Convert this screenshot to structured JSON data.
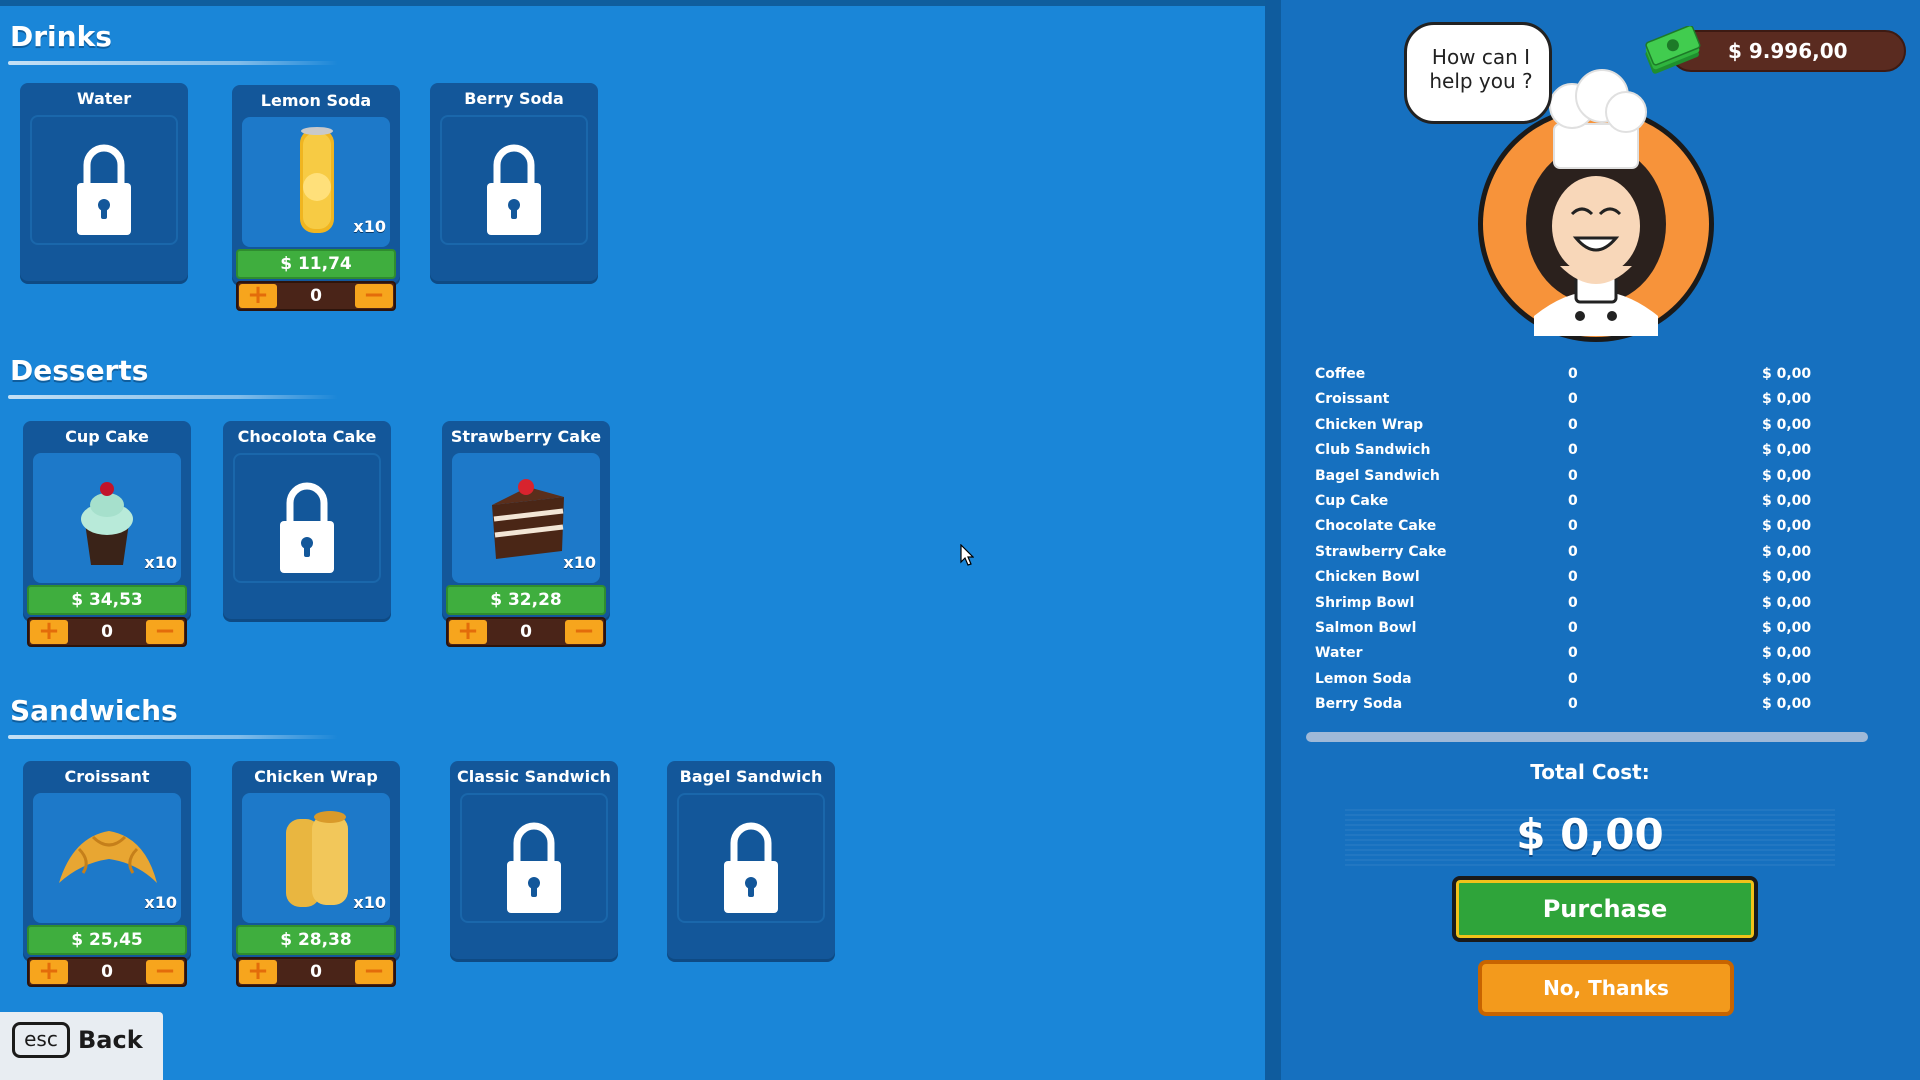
{
  "sections": {
    "drinks": {
      "title": "Drinks"
    },
    "desserts": {
      "title": "Desserts"
    },
    "sandwichs": {
      "title": "Sandwichs"
    }
  },
  "items": {
    "water": {
      "name": "Water",
      "locked": true
    },
    "lemon_soda": {
      "name": "Lemon Soda",
      "price": "$ 11,74",
      "qty_tag": "x10",
      "count": "0"
    },
    "berry_soda": {
      "name": "Berry Soda",
      "locked": true
    },
    "cup_cake": {
      "name": "Cup Cake",
      "price": "$ 34,53",
      "qty_tag": "x10",
      "count": "0"
    },
    "chocolota_cake": {
      "name": "Chocolota Cake",
      "locked": true
    },
    "strawberry_cake": {
      "name": "Strawberry Cake",
      "price": "$ 32,28",
      "qty_tag": "x10",
      "count": "0"
    },
    "croissant": {
      "name": "Croissant",
      "price": "$ 25,45",
      "qty_tag": "x10",
      "count": "0"
    },
    "chicken_wrap": {
      "name": "Chicken Wrap",
      "price": "$ 28,38",
      "qty_tag": "x10",
      "count": "0"
    },
    "classic_sandwich": {
      "name": "Classic Sandwich",
      "locked": true
    },
    "bagel_sandwich": {
      "name": "Bagel Sandwich",
      "locked": true
    }
  },
  "stepper": {
    "plus": "+",
    "minus": "−"
  },
  "back": {
    "key": "esc",
    "label": "Back"
  },
  "wallet": {
    "amount": "$ 9.996,00",
    "icon": "cash-stack-icon"
  },
  "chef": {
    "speech": "How can I help you ?"
  },
  "order": [
    {
      "name": "Coffee",
      "qty": "0",
      "cost": "$ 0,00"
    },
    {
      "name": "Croissant",
      "qty": "0",
      "cost": "$ 0,00"
    },
    {
      "name": "Chicken Wrap",
      "qty": "0",
      "cost": "$ 0,00"
    },
    {
      "name": "Club Sandwich",
      "qty": "0",
      "cost": "$ 0,00"
    },
    {
      "name": "Bagel Sandwich",
      "qty": "0",
      "cost": "$ 0,00"
    },
    {
      "name": "Cup Cake",
      "qty": "0",
      "cost": "$ 0,00"
    },
    {
      "name": "Chocolate Cake",
      "qty": "0",
      "cost": "$ 0,00"
    },
    {
      "name": "Strawberry Cake",
      "qty": "0",
      "cost": "$ 0,00"
    },
    {
      "name": "Chicken Bowl",
      "qty": "0",
      "cost": "$ 0,00"
    },
    {
      "name": "Shrimp Bowl",
      "qty": "0",
      "cost": "$ 0,00"
    },
    {
      "name": "Salmon Bowl",
      "qty": "0",
      "cost": "$ 0,00"
    },
    {
      "name": "Water",
      "qty": "0",
      "cost": "$ 0,00"
    },
    {
      "name": "Lemon Soda",
      "qty": "0",
      "cost": "$ 0,00"
    },
    {
      "name": "Berry Soda",
      "qty": "0",
      "cost": "$ 0,00"
    }
  ],
  "total": {
    "label": "Total Cost:",
    "value": "$ 0,00"
  },
  "buttons": {
    "purchase": "Purchase",
    "no_thanks": "No, Thanks"
  },
  "colors": {
    "background": "#1a84d6",
    "price_green": "#3fae3e",
    "stepper_orange": "#f7a51d",
    "purchase_green": "#2fa43a",
    "cancel_orange": "#f39a1c"
  }
}
